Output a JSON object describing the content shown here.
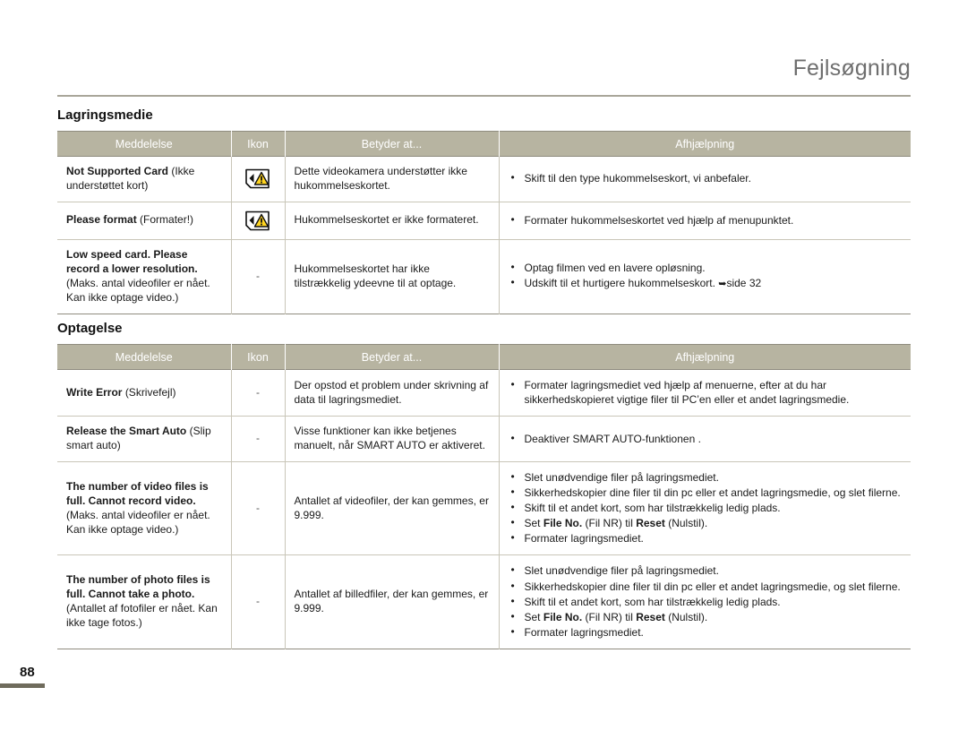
{
  "header": {
    "title": "Fejlsøgning"
  },
  "page": {
    "number": "88"
  },
  "table_columns": {
    "message": "Meddelelse",
    "icon": "Ikon",
    "means": "Betyder at...",
    "remedy": "Afhjælpning"
  },
  "icons": {
    "warning_card": "sd-card-warning-icon",
    "none": "-",
    "page_ref_arrow": "➥"
  },
  "sections": [
    {
      "id": "lagringsmedie",
      "title": "Lagringsmedie",
      "rows": [
        {
          "message_en": "Not Supported Card",
          "message_da": "(Ikke understøttet kort)",
          "icon": "sd-card-warning-icon",
          "means": "Dette videokamera understøtter ikke hukommelseskortet.",
          "remedy": [
            {
              "text": "Skift til den type hukommelseskort, vi anbefaler."
            }
          ]
        },
        {
          "message_en": "Please format",
          "message_da": "(Formater!)",
          "icon": "sd-card-warning-icon",
          "means": "Hukommelseskortet er ikke formateret.",
          "remedy": [
            {
              "text": "Formater hukommelseskortet ved hjælp af menupunktet."
            }
          ]
        },
        {
          "message_en": "Low speed card. Please record a lower resolution.",
          "message_da": "(Maks. antal videofiler er nået. Kan ikke optage video.)",
          "icon": "-",
          "means": "Hukommelseskortet har ikke tilstrækkelig ydeevne til at optage.",
          "remedy": [
            {
              "text": "Optag filmen ved en lavere opløsning."
            },
            {
              "text": "Udskift til et hurtigere hukommelseskort. ➥side 32"
            }
          ]
        }
      ]
    },
    {
      "id": "optagelse",
      "title": "Optagelse",
      "rows": [
        {
          "message_en": "Write Error",
          "message_da": "(Skrivefejl)",
          "icon": "-",
          "means": "Der opstod et problem under skrivning af data til lagringsmediet.",
          "remedy": [
            {
              "text": "Formater lagringsmediet ved hjælp af menuerne, efter at du har sikkerhedskopieret vigtige filer til PC’en eller et andet lagringsmedie."
            }
          ]
        },
        {
          "message_en": "Release the Smart Auto",
          "message_da": "(Slip smart auto)",
          "icon": "-",
          "means": "Visse funktioner kan ikke betjenes manuelt, når SMART AUTO er aktiveret.",
          "remedy": [
            {
              "text": "Deaktiver SMART AUTO-funktionen ."
            }
          ]
        },
        {
          "message_en": "The number of video files is full. Cannot record video.",
          "message_da": "(Maks. antal videofiler er nået. Kan ikke optage video.)",
          "icon": "-",
          "means": "Antallet af videofiler, der kan gemmes, er 9.999.",
          "remedy": [
            {
              "text": "Slet unødvendige filer på lagringsmediet."
            },
            {
              "text": "Sikkerhedskopier dine filer til din pc eller et andet lagringsmedie, og slet filerne."
            },
            {
              "text": "Skift til et andet kort, som har tilstrækkelig ledig plads."
            },
            {
              "text": "Set File No. (Fil NR) til Reset (Nulstil).",
              "rich": true
            },
            {
              "text": "Formater lagringsmediet."
            }
          ]
        },
        {
          "message_en": "The number of photo files is full. Cannot take a photo.",
          "message_da": "(Antallet af fotofiler er nået. Kan ikke tage fotos.)",
          "icon": "-",
          "means": "Antallet af billedfiler, der kan gemmes, er 9.999.",
          "remedy": [
            {
              "text": "Slet unødvendige filer på lagringsmediet."
            },
            {
              "text": "Sikkerhedskopier dine filer til din pc eller et andet lagringsmedie, og slet filerne."
            },
            {
              "text": "Skift til et andet kort, som har tilstrækkelig ledig plads."
            },
            {
              "text": "Set File No. (Fil NR) til Reset (Nulstil).",
              "rich": true
            },
            {
              "text": "Formater lagringsmediet."
            }
          ]
        }
      ]
    }
  ],
  "rich_bullet": {
    "prefix": "Set ",
    "bold1": "File No.",
    "mid1": " (Fil NR) til ",
    "bold2": "Reset",
    "suffix": " (Nulstil)."
  },
  "colors": {
    "header_band": "#b7b4a1",
    "rule": "#a9a69a",
    "title_text": "#6e6e6e",
    "warning_yellow": "#ffd420",
    "page_rule": "#6f6b5c"
  }
}
